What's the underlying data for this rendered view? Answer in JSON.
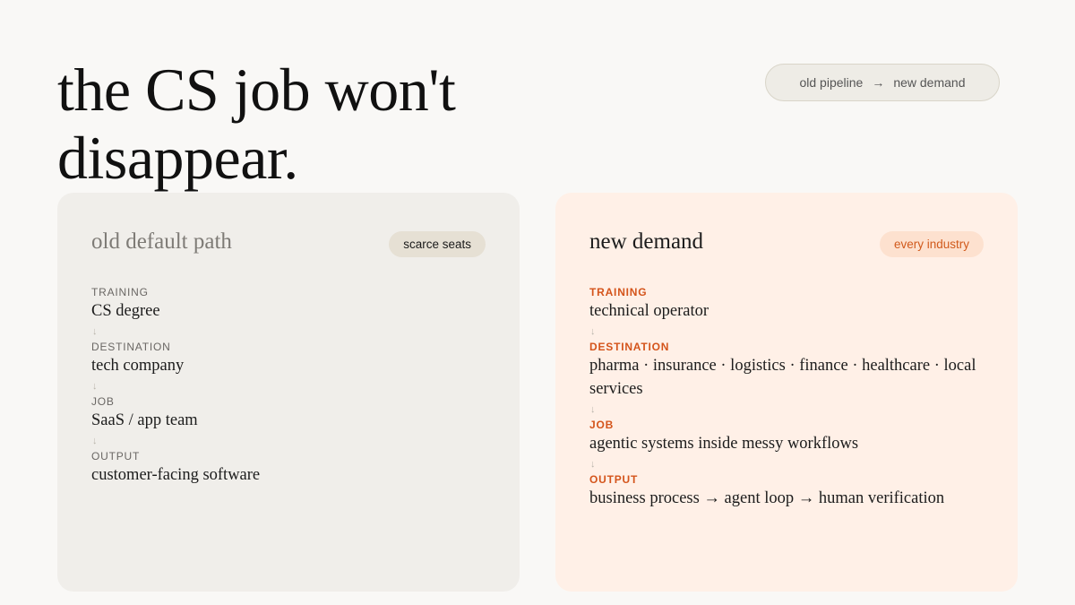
{
  "headline": "the CS job won't disappear.",
  "pill": {
    "left": "old pipeline",
    "arrow": "→",
    "right": "new demand"
  },
  "old_card": {
    "title": "old default path",
    "badge": "scarce seats",
    "steps": [
      {
        "label": "TRAINING",
        "value": "CS degree"
      },
      {
        "label": "DESTINATION",
        "value": "tech company"
      },
      {
        "label": "JOB",
        "value": "SaaS / app team"
      },
      {
        "label": "OUTPUT",
        "value": "customer-facing software"
      }
    ]
  },
  "new_card": {
    "title": "new demand",
    "badge": "every industry",
    "steps": [
      {
        "label": "TRAINING",
        "value": "technical operator"
      },
      {
        "label": "DESTINATION",
        "value": "pharma · insurance · logistics · finance · healthcare · local services"
      },
      {
        "label": "JOB",
        "value": "agentic systems inside messy workflows"
      },
      {
        "label": "OUTPUT",
        "value": "business process → agent loop → human verification"
      }
    ]
  },
  "down_arrow": "↓",
  "colors": {
    "background": "#f9f8f6",
    "old_card": "#f0eeea",
    "new_card": "#fff0e7",
    "accent": "#d4541b"
  }
}
